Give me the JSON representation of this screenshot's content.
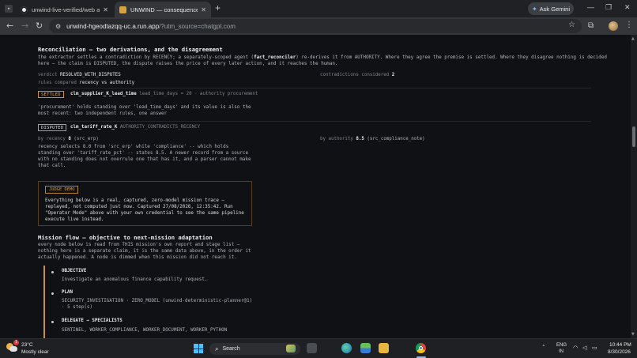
{
  "browser": {
    "tabs": [
      {
        "title": "unwind-live-verified/web at m...",
        "active": false
      },
      {
        "title": "UNWIND — consequence clear...",
        "active": true
      }
    ],
    "ask_gemini": "Ask Gemini",
    "url_host": "unwind-hgeodtazqq-uc.a.run.app",
    "url_path": "/?utm_source=chatgpt.com"
  },
  "reconciliation": {
    "heading": "Reconciliation — two derivations, and the disagreement",
    "intro_line1_a": "the extractor settles a contradiction by RECENCY; a separately-scoped agent (",
    "intro_agent": "fact_reconciler",
    "intro_line1_b": ") re-derives it from AUTHORITY. Where they agree the premise is settled. Where they disagree nothing is decided",
    "intro_line2": "here — the claim is DISPUTED, the dispute raises the price of every later action, and it reaches the human.",
    "verdict_label": "verdict",
    "verdict_value": "RESOLVED_WITH_DISPUTES",
    "contradictions_label": "contradictions considered",
    "contradictions_value": "2",
    "rules_label": "rules compared",
    "rules_value": "recency vs authority",
    "settled": {
      "badge": "SETTLED",
      "claim": "clm_supplier_K_lead_time",
      "detail": "lead_time_days = 20 · authority procurement",
      "note_line1": "'procurement' holds standing over 'lead_time_days' and its value is also the",
      "note_line2": "most recent: two independent rules, one answer"
    },
    "disputed": {
      "badge": "DISPUTED",
      "claim": "clm_tariff_rate_K",
      "detail": "AUTHORITY_CONTRADICTS_RECENCY",
      "by_recency_label": "by recency",
      "by_recency_value": "8",
      "by_recency_src": "(src_erp)",
      "by_authority_label": "by authority",
      "by_authority_value": "8.5",
      "by_authority_src": "(src_compliance_note)",
      "note_line1": "recency selects 8.0 from 'src_erp' while 'compliance' -- which holds",
      "note_line2": "standing over 'tariff_rate_pct' -- states 8.5. A newer record from a source",
      "note_line3": "with no standing does not overrule one that has it, and a parser cannot make",
      "note_line4": "that call."
    }
  },
  "judge_demo": {
    "tag": "JUDGE DEMO",
    "line1": "Everything below is a real, captured, zero-model mission trace —",
    "line2": "replayed, not computed just now. Captured 27/08/2026, 12:35:42. Run",
    "line3": "\"Operator Mode\" above with your own credential to see the same pipeline",
    "line4": "execute live instead."
  },
  "mission_flow": {
    "heading": "Mission flow — objective to next-mission adaptation",
    "intro_line1": "every node below is read from THIS mission's own report and stage list —",
    "intro_line2": "nothing here is a separate claim, it is the same data above, in the order it",
    "intro_line3": "actually happened. A node is dimmed when this mission did not reach it.",
    "nodes": [
      {
        "title": "OBJECTIVE",
        "body": "Investigate an anomalous finance capability request.",
        "body2": ""
      },
      {
        "title": "PLAN",
        "body": "SECURITY_INVESTIGATION · ZERO_MODEL (unwind-deterministic-planner@1)",
        "body2": "· 5 step(s)"
      },
      {
        "title": "DELEGATE → SPECIALISTS",
        "body": "SENTINEL, WORKER_COMPLIANCE, WORKER_DOCUMENT, WORKER_PYTHON",
        "body2": ""
      }
    ]
  },
  "taskbar": {
    "temperature": "23°C",
    "weather": "Mostly clear",
    "search_label": "Search",
    "lang_top": "ENG",
    "lang_bottom": "IN",
    "time": "10:44 PM",
    "date": "8/30/2026"
  }
}
